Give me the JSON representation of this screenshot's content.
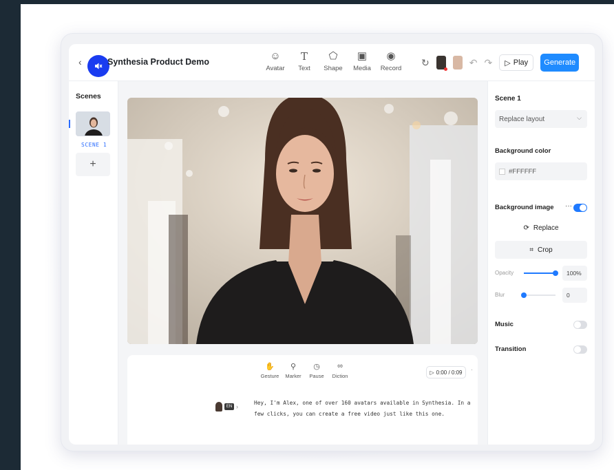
{
  "project": {
    "title": "Synthesia Product Demo"
  },
  "toolbar": {
    "tools": [
      {
        "label": "Avatar",
        "icon": "avatar-icon"
      },
      {
        "label": "Text",
        "icon": "text-icon"
      },
      {
        "label": "Shape",
        "icon": "shape-icon"
      },
      {
        "label": "Media",
        "icon": "media-icon"
      },
      {
        "label": "Record",
        "icon": "record-icon"
      }
    ],
    "play_label": "Play",
    "generate_label": "Generate"
  },
  "scenes": {
    "title": "Scenes",
    "items": [
      {
        "label": "SCENE 1"
      }
    ],
    "add_label": "+"
  },
  "script": {
    "tools": [
      {
        "label": "Gesture",
        "icon": "gesture-icon"
      },
      {
        "label": "Marker",
        "icon": "marker-icon"
      },
      {
        "label": "Pause",
        "icon": "pause-icon"
      },
      {
        "label": "Diction",
        "icon": "diction-icon"
      }
    ],
    "timer": "0:00 / 0:09",
    "language": "EN",
    "text": "Hey, I'm Alex, one of over 160 avatars available in Synthesia. In a few clicks, you can create a free video just like this one."
  },
  "properties": {
    "scene_title": "Scene 1",
    "layout_select": "Replace layout",
    "background_color_label": "Background color",
    "background_color_value": "#FFFFFF",
    "background_image_label": "Background image",
    "background_image_enabled": true,
    "replace_label": "Replace",
    "crop_label": "Crop",
    "opacity_label": "Opacity",
    "opacity_value": "100%",
    "opacity_fraction": 1.0,
    "blur_label": "Blur",
    "blur_value": "0",
    "blur_fraction": 0.0,
    "music_label": "Music",
    "music_enabled": false,
    "transition_label": "Transition",
    "transition_enabled": false
  },
  "colors": {
    "accent": "#1f8bff",
    "mute_button": "#1a3cf0"
  }
}
